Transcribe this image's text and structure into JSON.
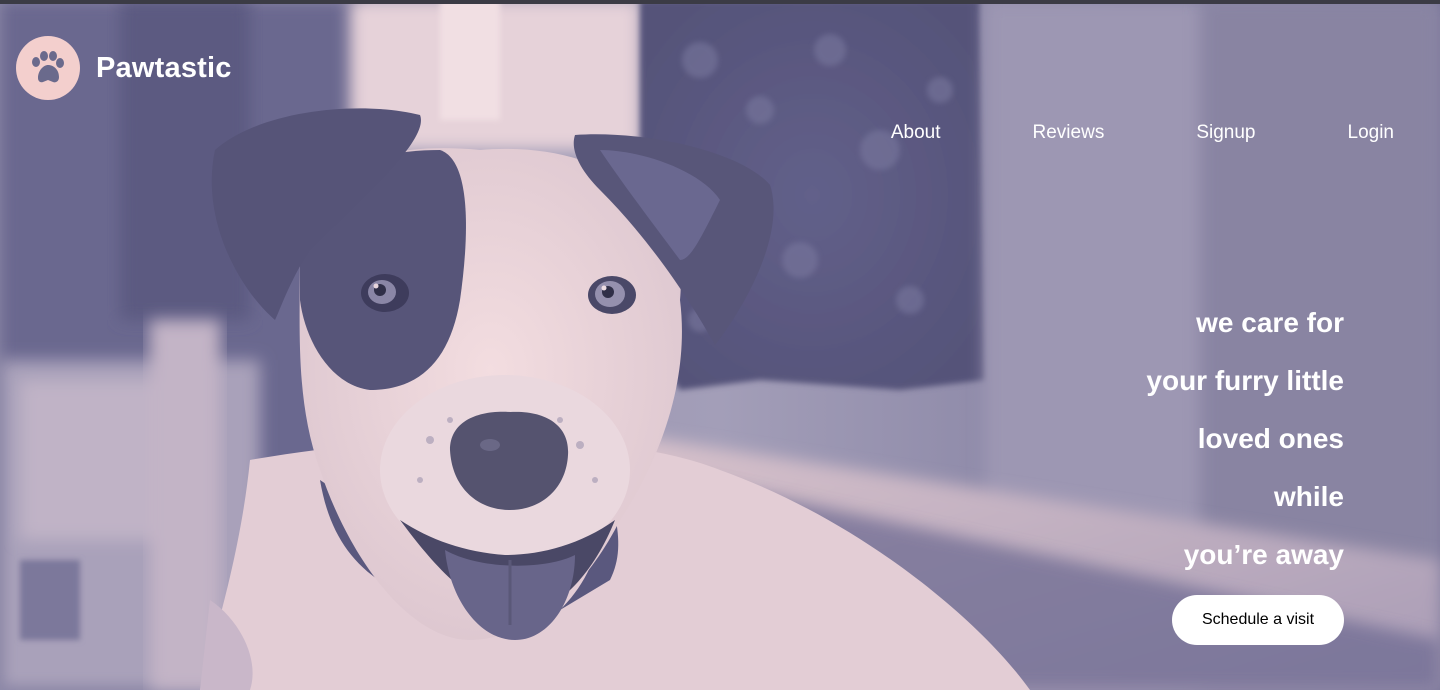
{
  "brand": {
    "name": "Pawtastic",
    "logo_icon": "paw-icon",
    "logo_bg": "#f3cfcd",
    "logo_fg": "#6a6a8c"
  },
  "nav": {
    "items": [
      {
        "label": "About"
      },
      {
        "label": "Reviews"
      },
      {
        "label": "Signup"
      },
      {
        "label": "Login"
      }
    ]
  },
  "hero": {
    "tagline_lines": [
      "we care for",
      "your furry little",
      "loved ones",
      "while",
      "you’re away"
    ],
    "cta_label": "Schedule a visit",
    "colors": {
      "tint_dark": "#5f5e85",
      "tint_light": "#f0d5d8",
      "text": "#ffffff"
    }
  }
}
